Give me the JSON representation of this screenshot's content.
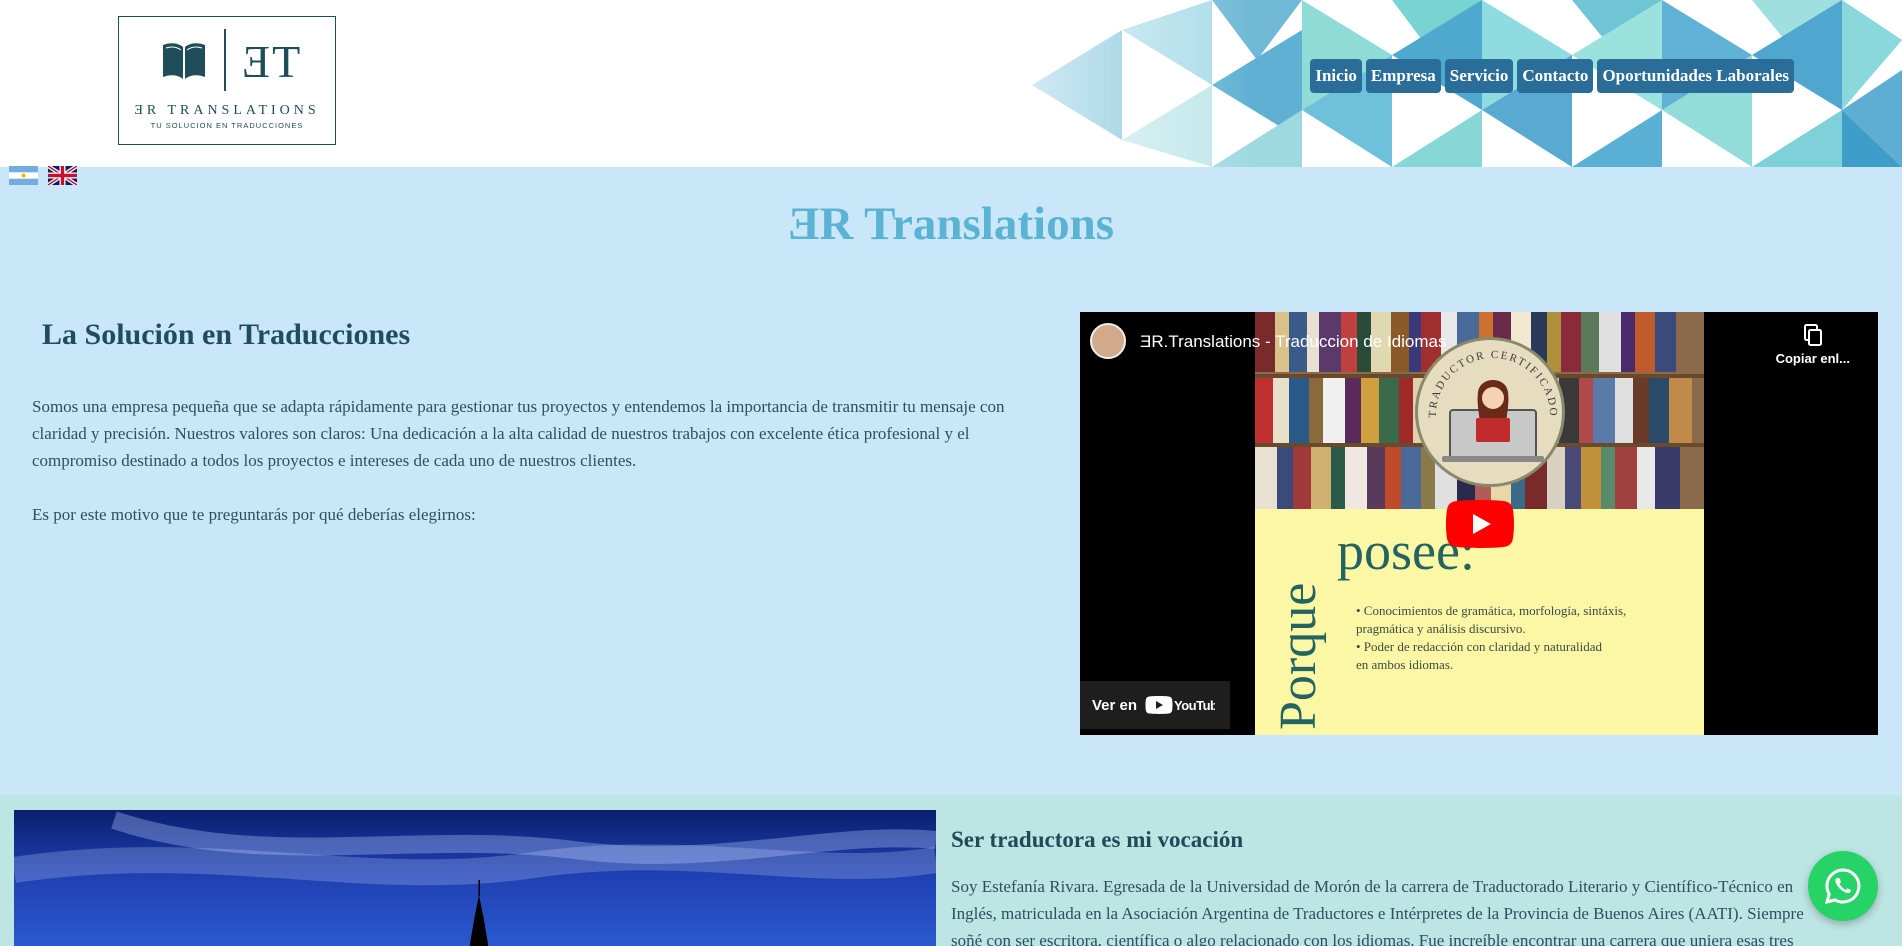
{
  "header": {
    "logo": {
      "monogram": "ƎT",
      "name": "ƎR TRANSLATIONS",
      "tagline": "TU SOLUCION EN TRADUCCIONES"
    },
    "nav": [
      {
        "label": "Inicio"
      },
      {
        "label": "Empresa"
      },
      {
        "label": "Servicio"
      },
      {
        "label": "Contacto"
      },
      {
        "label": "Oportunidades Laborales"
      }
    ]
  },
  "languages": [
    {
      "icon": "argentina-flag-icon"
    },
    {
      "icon": "uk-flag-icon"
    }
  ],
  "site_title": "ƎR Translations",
  "intro": {
    "heading": "La Solución en Traducciones",
    "paragraph1": "Somos una empresa pequeña que se adapta rápidamente para gestionar tus proyectos y entendemos la importancia de transmitir tu mensaje con claridad y precisión. Nuestros valores son claros: Una dedicación a la alta calidad de nuestros trabajos con excelente ética profesional y el compromiso destinado a todos los proyectos e intereses de cada uno de nuestros clientes.",
    "paragraph2": "Es por este motivo que te preguntarás por qué deberías elegirnos:"
  },
  "video": {
    "title": "ƎR.Translations - Traduccion de Idiomas",
    "copy_label": "Copiar enl...",
    "watch_on": "Ver en",
    "youtube": "YouTube",
    "thumbnail": {
      "badge_text": "TRADUCTOR CERTIFICADO",
      "vertical_word": "Porque",
      "word": "posee:",
      "bullets": [
        "• Conocimientos de gramática, morfología, sintáxis,",
        "pragmática y análisis discursivo.",
        "• Poder de redacción con claridad y naturalidad",
        "en ambos idiomas."
      ]
    }
  },
  "vocation": {
    "heading": "Ser traductora es mi vocación",
    "text": "Soy Estefanía Rivara. Egresada de la Universidad de Morón de la carrera de Traductorado Literario y Científico-Técnico en Inglés, matriculada en la Asociación Argentina de Traductores e Intérpretes de la Provincia de Buenos Aires (AATI). Siempre soñé con ser escritora, científica o algo relacionado con los idiomas. Fue increíble encontrar una carrera que uniera esas tres pasiones. Me"
  },
  "colors": {
    "nav_bg": "#2a6d99",
    "title": "#5ab3d3",
    "page_bg": "#c9e7f8",
    "section2_bg": "#bde5e3",
    "whatsapp": "#25d366"
  }
}
